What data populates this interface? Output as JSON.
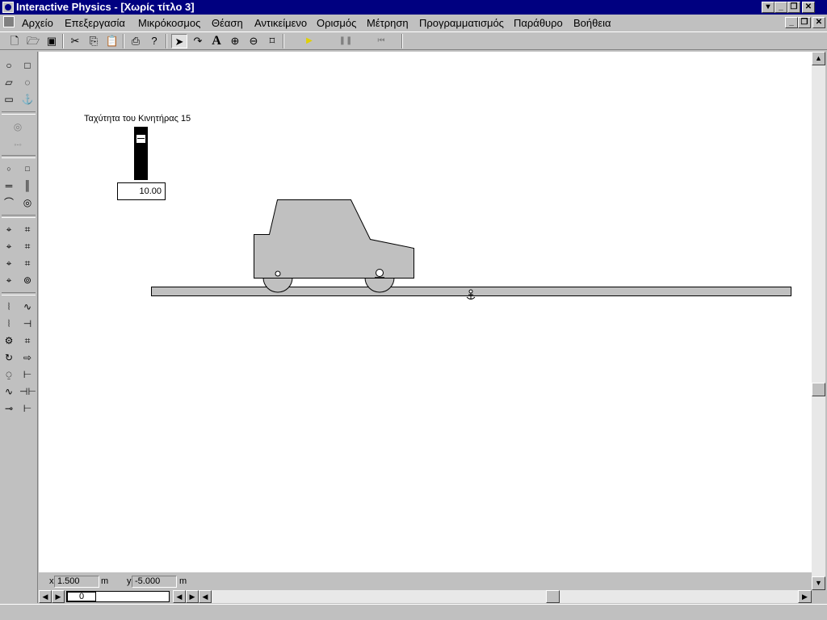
{
  "window": {
    "title": "Interactive Physics - [Χωρίς τίτλο 3]"
  },
  "menu": {
    "items": [
      "Αρχείο",
      "Επεξεργασία",
      "Μικρόκοσμος",
      "Θέαση",
      "Αντικείμενο",
      "Ορισμός",
      "Μέτρηση",
      "Προγραμματισμός",
      "Παράθυρο",
      "Βοήθεια"
    ]
  },
  "toolbar": {
    "icons": [
      "new-file-icon",
      "open-folder-icon",
      "save-icon",
      "cut-icon",
      "copy-icon",
      "paste-icon",
      "print-icon",
      "help-icon",
      "arrow-select-icon",
      "rotate-icon",
      "text-tool-icon",
      "zoom-in-icon",
      "zoom-out-icon",
      "zoom-fit-icon",
      "run-icon",
      "pause-icon",
      "reset-icon"
    ]
  },
  "slider": {
    "label": "Ταχύτητα του Κινητήρας 15",
    "value": "10.00",
    "level": 0.85
  },
  "coords": {
    "x_label": "x",
    "x_value": "1.500",
    "x_unit": "m",
    "y_label": "y",
    "y_value": "-5.000",
    "y_unit": "m"
  },
  "frame": {
    "value": "0"
  },
  "colors": {
    "titlebar": "#000080",
    "chrome": "#c0c0c0",
    "body_fill": "#c0c0c0"
  }
}
